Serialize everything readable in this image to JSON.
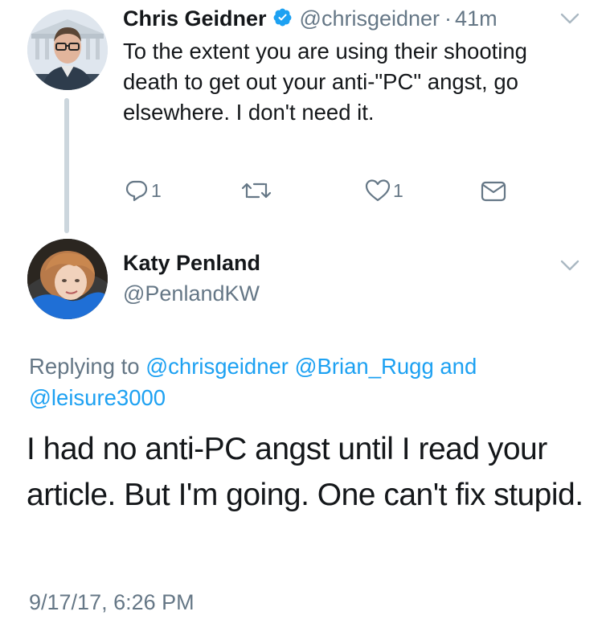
{
  "tweet1": {
    "author_name": "Chris Geidner",
    "author_handle": "@chrisgeidner",
    "separator": "·",
    "time_ago": "41m",
    "text": "To the extent you are using their shooting death to get out your anti-\"PC\" angst, go elsewhere. I don't need it.",
    "verified": true,
    "reply_count": "1",
    "like_count": "1",
    "icons": [
      "reply-icon",
      "retweet-icon",
      "like-icon",
      "direct-message-icon",
      "chevron-down-icon",
      "verified-badge-icon"
    ]
  },
  "tweet2": {
    "author_name": "Katy Penland",
    "author_handle": "@PenlandKW",
    "replying_prefix": "Replying to",
    "mention_1": "@chrisgeidner",
    "mention_2": "@Brian_Rugg",
    "conjunction": "and",
    "mention_3": "@leisure3000",
    "text": "I had no anti-PC angst until I read your article. But I'm going. One can't fix stupid.",
    "timestamp": "9/17/17, 6:26 PM",
    "icons": [
      "chevron-down-icon"
    ]
  },
  "colors": {
    "link": "#1da1f2",
    "secondary_text": "#657786",
    "primary_text": "#14171a",
    "thread_line": "#ccd6dd",
    "verified_badge": "#1da1f2"
  }
}
